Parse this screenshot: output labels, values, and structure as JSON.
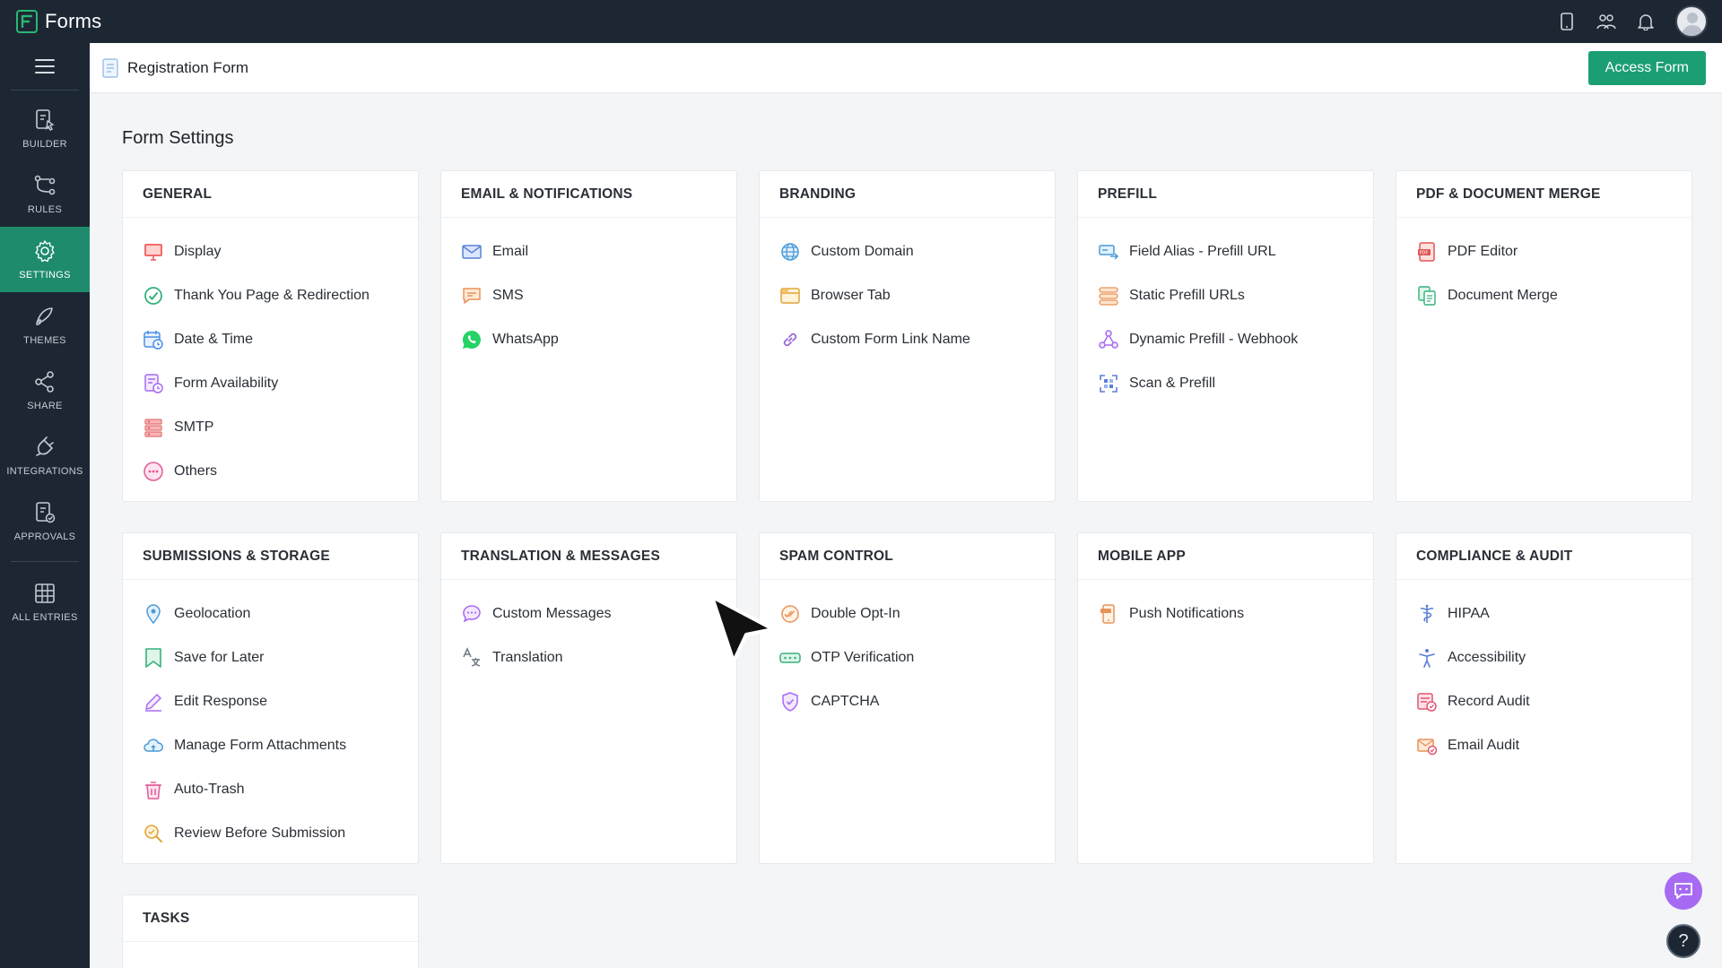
{
  "app": {
    "name": "Forms"
  },
  "header": {
    "form_title": "Registration Form",
    "access_button": "Access Form"
  },
  "sidebar": {
    "items": [
      {
        "label": "BUILDER",
        "icon": "builder-icon"
      },
      {
        "label": "RULES",
        "icon": "rules-icon"
      },
      {
        "label": "SETTINGS",
        "icon": "gear-icon",
        "active": true
      },
      {
        "label": "THEMES",
        "icon": "themes-icon"
      },
      {
        "label": "SHARE",
        "icon": "share-icon"
      },
      {
        "label": "INTEGRATIONS",
        "icon": "integrations-icon"
      },
      {
        "label": "APPROVALS",
        "icon": "approvals-icon"
      },
      {
        "label": "ALL ENTRIES",
        "icon": "grid-icon"
      }
    ]
  },
  "page": {
    "title": "Form Settings"
  },
  "cards": [
    {
      "title": "GENERAL",
      "items": [
        "Display",
        "Thank You Page & Redirection",
        "Date & Time",
        "Form Availability",
        "SMTP",
        "Others"
      ]
    },
    {
      "title": "EMAIL & NOTIFICATIONS",
      "items": [
        "Email",
        "SMS",
        "WhatsApp"
      ]
    },
    {
      "title": "BRANDING",
      "items": [
        "Custom Domain",
        "Browser Tab",
        "Custom Form Link Name"
      ]
    },
    {
      "title": "PREFILL",
      "items": [
        "Field Alias - Prefill URL",
        "Static Prefill URLs",
        "Dynamic Prefill - Webhook",
        "Scan & Prefill"
      ]
    },
    {
      "title": "PDF & DOCUMENT MERGE",
      "items": [
        "PDF Editor",
        "Document Merge"
      ]
    },
    {
      "title": "SUBMISSIONS & STORAGE",
      "items": [
        "Geolocation",
        "Save for Later",
        "Edit Response",
        "Manage Form Attachments",
        "Auto-Trash",
        "Review Before Submission"
      ]
    },
    {
      "title": "TRANSLATION & MESSAGES",
      "items": [
        "Custom Messages",
        "Translation"
      ]
    },
    {
      "title": "SPAM CONTROL",
      "items": [
        "Double Opt-In",
        "OTP Verification",
        "CAPTCHA"
      ]
    },
    {
      "title": "MOBILE APP",
      "items": [
        "Push Notifications"
      ]
    },
    {
      "title": "COMPLIANCE & AUDIT",
      "items": [
        "HIPAA",
        "Accessibility",
        "Record Audit",
        "Email Audit"
      ]
    },
    {
      "title": "TASKS",
      "items": []
    }
  ],
  "colors": {
    "topbar": "#1d2733",
    "accent": "#1c9e75",
    "active_nav": "#1e8c6c",
    "chat": "#a66bf2"
  }
}
